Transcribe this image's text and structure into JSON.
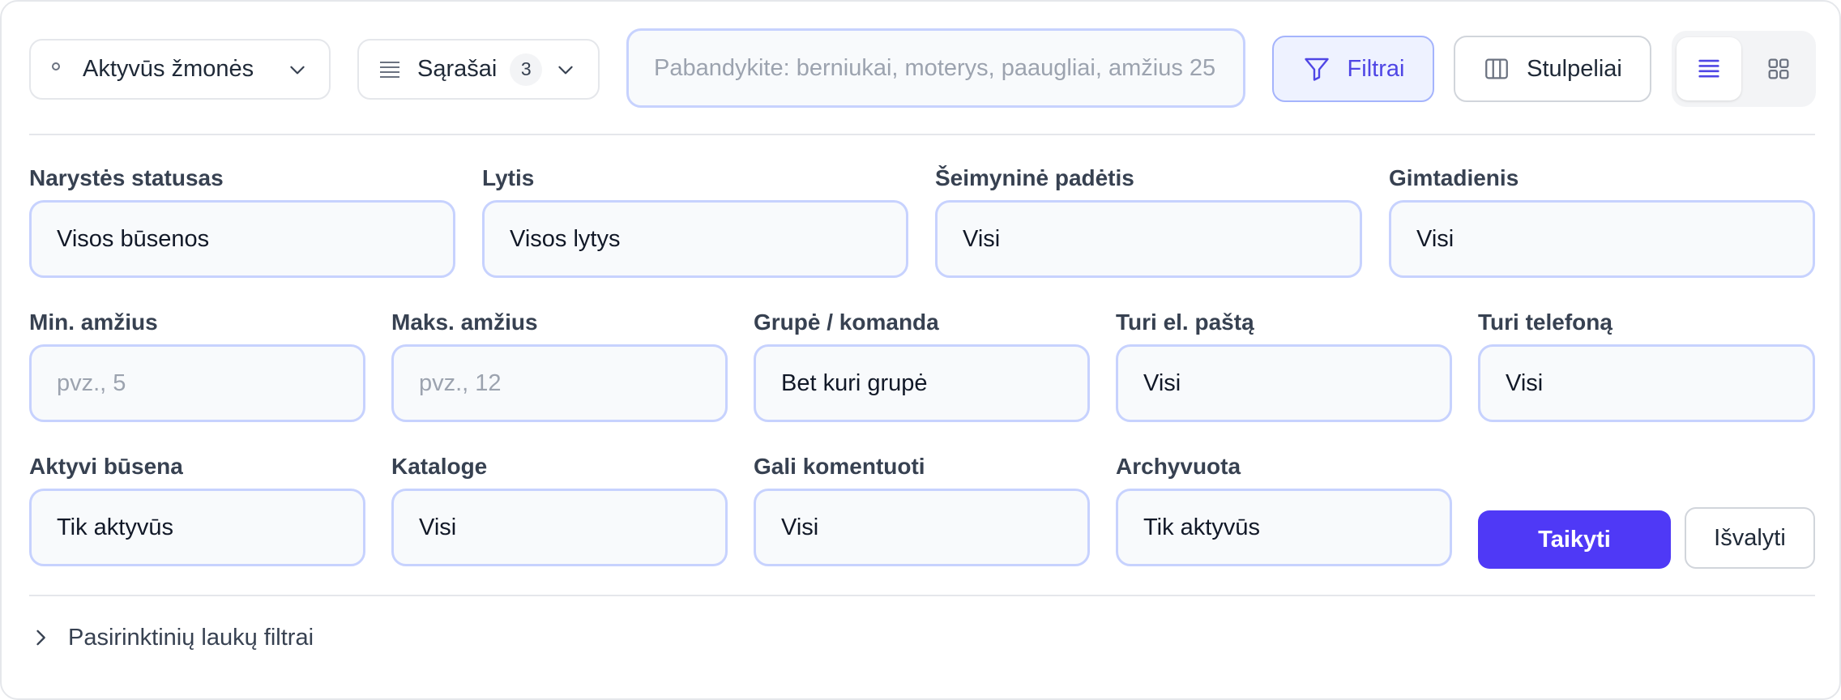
{
  "toolbar": {
    "people_scope": "Aktyvūs žmonės",
    "lists_label": "Sąrašai",
    "lists_count": "3",
    "search_placeholder": "Pabandykite: berniukai, moterys, paaugliai, amžius 25",
    "filters_label": "Filtrai",
    "columns_label": "Stulpeliai",
    "active_view": "list"
  },
  "filters": {
    "membership": {
      "label": "Narystės statusas",
      "value": "Visos būsenos"
    },
    "gender": {
      "label": "Lytis",
      "value": "Visos lytys"
    },
    "marital": {
      "label": "Šeimyninė padėtis",
      "value": "Visi"
    },
    "birthday": {
      "label": "Gimtadienis",
      "value": "Visi"
    },
    "min_age": {
      "label": "Min. amžius",
      "placeholder": "pvz., 5"
    },
    "max_age": {
      "label": "Maks. amžius",
      "placeholder": "pvz., 12"
    },
    "group": {
      "label": "Grupė / komanda",
      "value": "Bet kuri grupė"
    },
    "has_email": {
      "label": "Turi el. paštą",
      "value": "Visi"
    },
    "has_phone": {
      "label": "Turi telefoną",
      "value": "Visi"
    },
    "active_status": {
      "label": "Aktyvi būsena",
      "value": "Tik aktyvūs"
    },
    "directory": {
      "label": "Kataloge",
      "value": "Visi"
    },
    "can_comment": {
      "label": "Gali komentuoti",
      "value": "Visi"
    },
    "archived": {
      "label": "Archyvuota",
      "value": "Tik aktyvūs"
    }
  },
  "actions": {
    "apply_label": "Taikyti",
    "clear_label": "Išvalyti"
  },
  "custom_fields": {
    "label": "Pasirinktinių laukų filtrai"
  },
  "colors": {
    "accent": "#4f39f6",
    "field_border": "#c7d2fe",
    "field_bg": "#f8fafc"
  }
}
